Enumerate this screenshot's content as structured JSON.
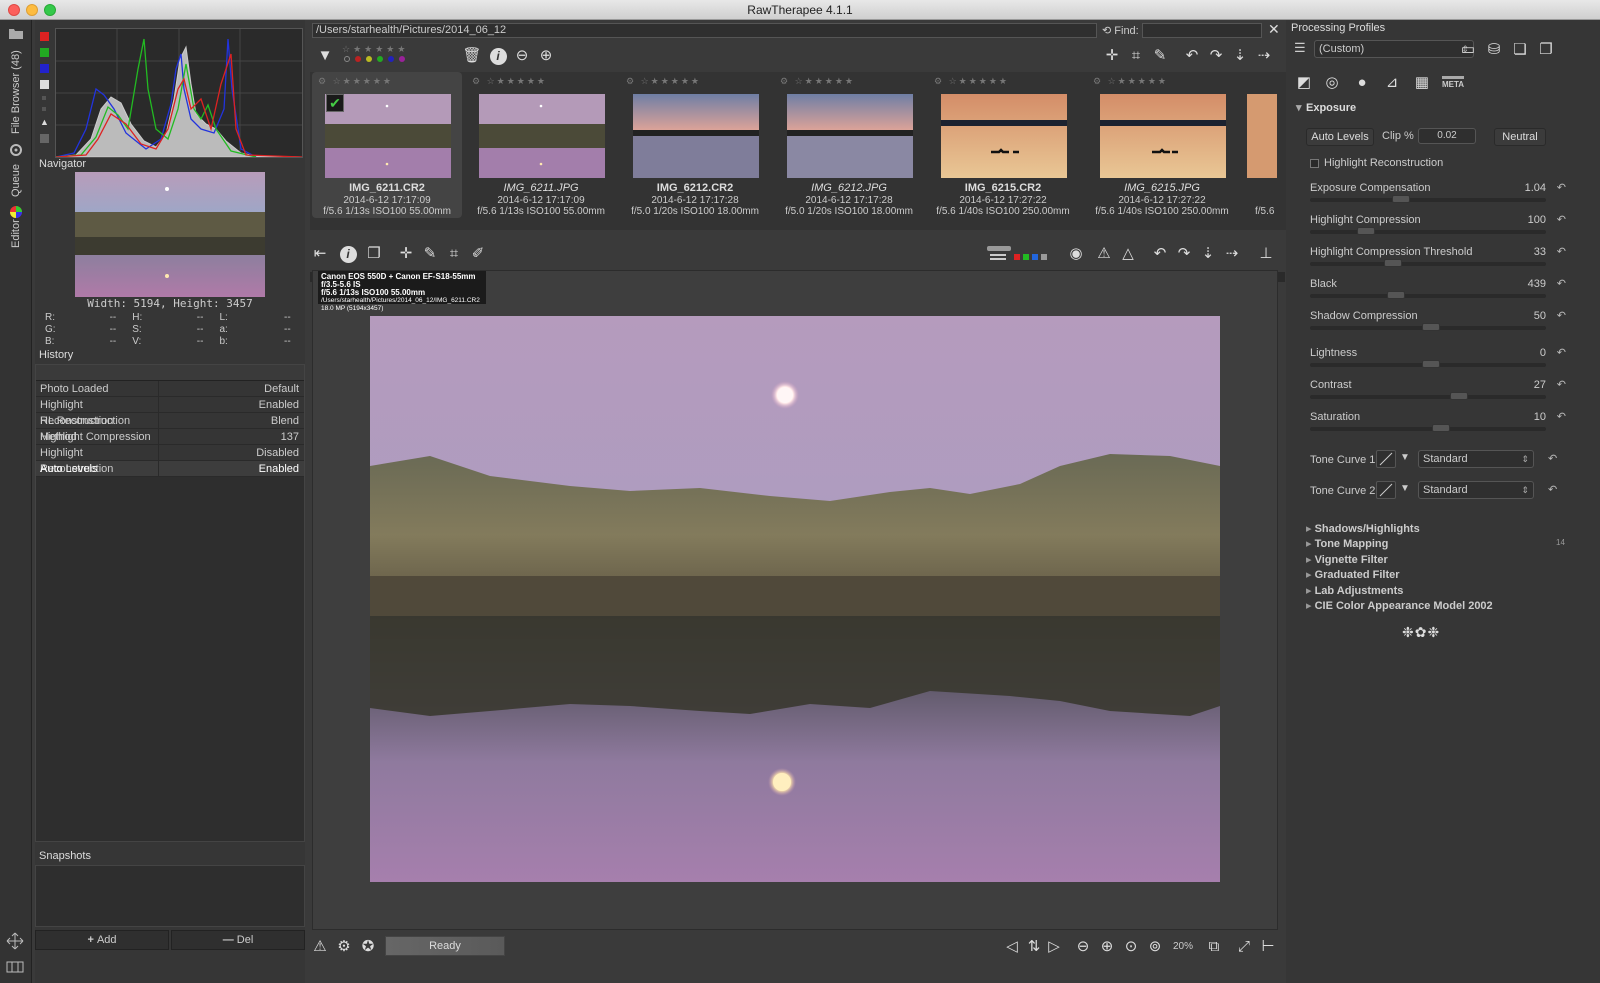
{
  "window": {
    "title": "RawTherapee 4.1.1"
  },
  "vtabs": {
    "file_browser": "File Browser (48)",
    "queue": "Queue",
    "editor": "Editor"
  },
  "navigator": {
    "title": "Navigator",
    "size_text": "Width: 5194, Height: 3457",
    "vals": [
      [
        "R:",
        "--",
        "H:",
        "--",
        "L:",
        "--"
      ],
      [
        "G:",
        "--",
        "S:",
        "--",
        "a:",
        "--"
      ],
      [
        "B:",
        "--",
        "V:",
        "--",
        "b:",
        "--"
      ]
    ]
  },
  "history": {
    "title": "History",
    "rows": [
      {
        "action": "Photo Loaded",
        "value": "Default"
      },
      {
        "action": "Highlight Reconstruction",
        "value": "Enabled"
      },
      {
        "action": "HL Reconstruction Method",
        "value": "Blend"
      },
      {
        "action": "Highlight Compression",
        "value": "137"
      },
      {
        "action": "Highlight Reconstruction",
        "value": "Disabled"
      },
      {
        "action": "Auto Levels",
        "value": "Enabled"
      }
    ]
  },
  "snapshots": {
    "title": "Snapshots",
    "add": "Add",
    "del": "Del"
  },
  "browser": {
    "path": "/Users/starhealth/Pictures/2014_06_12",
    "find_label": "Find:",
    "thumbs": [
      {
        "name": "IMG_6211.CR2",
        "date": "2014-6-12 17:17:09",
        "info": "f/5.6 1/13s ISO100 55.00mm",
        "italic": false
      },
      {
        "name": "IMG_6211.JPG",
        "date": "2014-6-12 17:17:09",
        "info": "f/5.6 1/13s ISO100 55.00mm",
        "italic": true
      },
      {
        "name": "IMG_6212.CR2",
        "date": "2014-6-12 17:17:28",
        "info": "f/5.0 1/20s ISO100 18.00mm",
        "italic": false
      },
      {
        "name": "IMG_6212.JPG",
        "date": "2014-6-12 17:17:28",
        "info": "f/5.0 1/20s ISO100 18.00mm",
        "italic": true
      },
      {
        "name": "IMG_6215.CR2",
        "date": "2014-6-12 17:27:22",
        "info": "f/5.6 1/40s ISO100 250.00mm",
        "italic": false
      },
      {
        "name": "IMG_6215.JPG",
        "date": "2014-6-12 17:27:22",
        "info": "f/5.6 1/40s ISO100 250.00mm",
        "italic": true
      },
      {
        "info": "f/5.6"
      }
    ]
  },
  "editor": {
    "exif_line1": "Canon EOS 550D + Canon EF-S18-55mm f/3.5-5.6 IS",
    "exif_line2": "f/5.6  1/13s  ISO100  55.00mm",
    "exif_line3": "/Users/starhealth/Pictures/2014_06_12/IMG_6211.CR2",
    "exif_line4": "18.0 MP (5194x3457)",
    "status": "Ready",
    "zoom": "20%"
  },
  "right": {
    "title": "Processing Profiles",
    "profile": "(Custom)",
    "tabs": [
      "exposure-tab",
      "detail-tab",
      "color-tab",
      "transform-tab",
      "raw-tab",
      "metadata-tab"
    ],
    "meta_label": "META",
    "exposure": {
      "title": "Exposure",
      "auto_levels": "Auto Levels",
      "clip_label": "Clip %",
      "clip_value": "0.02",
      "neutral": "Neutral",
      "hl_recon": "Highlight Reconstruction",
      "sliders": [
        {
          "label": "Exposure Compensation",
          "value": "1.04"
        },
        {
          "label": "Highlight Compression",
          "value": "100"
        },
        {
          "label": "Highlight Compression Threshold",
          "value": "33"
        },
        {
          "label": "Black",
          "value": "439"
        },
        {
          "label": "Shadow Compression",
          "value": "50"
        },
        {
          "label": "Lightness",
          "value": "0"
        },
        {
          "label": "Contrast",
          "value": "27"
        },
        {
          "label": "Saturation",
          "value": "10"
        }
      ],
      "tone_curve1": "Tone Curve 1:",
      "tone_curve2": "Tone Curve 2:",
      "curve_mode": "Standard"
    },
    "collapsed": [
      "Shadows/Highlights",
      "Tone Mapping",
      "Vignette Filter",
      "Graduated Filter",
      "Lab Adjustments",
      "CIE Color Appearance Model 2002"
    ],
    "tone_mapping_extra": "14"
  }
}
